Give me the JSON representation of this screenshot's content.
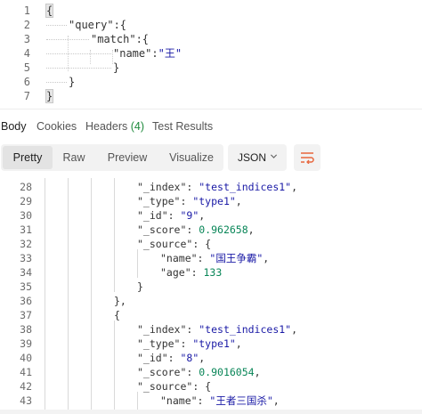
{
  "request_body": {
    "lines": [
      {
        "n": "1",
        "indent": 0,
        "parts": [
          {
            "t": "{",
            "c": "brace-sel"
          }
        ]
      },
      {
        "n": "2",
        "indent": 1,
        "parts": [
          {
            "t": "\"query\"",
            "c": "key"
          },
          {
            "t": ":{",
            "c": "p"
          }
        ]
      },
      {
        "n": "3",
        "indent": 2,
        "parts": [
          {
            "t": "\"match\"",
            "c": "key"
          },
          {
            "t": ":{",
            "c": "p"
          }
        ]
      },
      {
        "n": "4",
        "indent": 3,
        "parts": [
          {
            "t": "\"name\"",
            "c": "key"
          },
          {
            "t": ":",
            "c": "p"
          },
          {
            "t": "\"王\"",
            "c": "str"
          }
        ]
      },
      {
        "n": "5",
        "indent": 3,
        "parts": [
          {
            "t": "}",
            "c": "p"
          }
        ]
      },
      {
        "n": "6",
        "indent": 1,
        "parts": [
          {
            "t": "}",
            "c": "p"
          }
        ]
      },
      {
        "n": "7",
        "indent": 0,
        "parts": [
          {
            "t": "}",
            "c": "brace-sel"
          }
        ]
      }
    ]
  },
  "response_tabs": {
    "body": "Body",
    "cookies": "Cookies",
    "headers": "Headers",
    "headers_count": "(4)",
    "test_results": "Test Results"
  },
  "view_toolbar": {
    "pretty": "Pretty",
    "raw": "Raw",
    "preview": "Preview",
    "visualize": "Visualize",
    "format": "JSON",
    "chevron_icon": "chevron-down-icon",
    "wrap_icon": "wrap-lines-icon",
    "accent_color": "#e8663d"
  },
  "response_body": {
    "lines": [
      {
        "n": "28",
        "col": 5,
        "parts": [
          {
            "t": "\"_index\"",
            "c": "jk"
          },
          {
            "t": ": ",
            "c": "p"
          },
          {
            "t": "\"test_indices1\"",
            "c": "js"
          },
          {
            "t": ",",
            "c": "p"
          }
        ]
      },
      {
        "n": "29",
        "col": 5,
        "parts": [
          {
            "t": "\"_type\"",
            "c": "jk"
          },
          {
            "t": ": ",
            "c": "p"
          },
          {
            "t": "\"type1\"",
            "c": "js"
          },
          {
            "t": ",",
            "c": "p"
          }
        ]
      },
      {
        "n": "30",
        "col": 5,
        "parts": [
          {
            "t": "\"_id\"",
            "c": "jk"
          },
          {
            "t": ": ",
            "c": "p"
          },
          {
            "t": "\"9\"",
            "c": "js"
          },
          {
            "t": ",",
            "c": "p"
          }
        ]
      },
      {
        "n": "31",
        "col": 5,
        "parts": [
          {
            "t": "\"_score\"",
            "c": "jk"
          },
          {
            "t": ": ",
            "c": "p"
          },
          {
            "t": "0.962658",
            "c": "jn"
          },
          {
            "t": ",",
            "c": "p"
          }
        ]
      },
      {
        "n": "32",
        "col": 5,
        "parts": [
          {
            "t": "\"_source\"",
            "c": "jk"
          },
          {
            "t": ": {",
            "c": "p"
          }
        ]
      },
      {
        "n": "33",
        "col": 6,
        "parts": [
          {
            "t": "\"name\"",
            "c": "jk"
          },
          {
            "t": ": ",
            "c": "p"
          },
          {
            "t": "\"国王争霸\"",
            "c": "js"
          },
          {
            "t": ",",
            "c": "p"
          }
        ]
      },
      {
        "n": "34",
        "col": 6,
        "parts": [
          {
            "t": "\"age\"",
            "c": "jk"
          },
          {
            "t": ": ",
            "c": "p"
          },
          {
            "t": "133",
            "c": "jn"
          }
        ]
      },
      {
        "n": "35",
        "col": 5,
        "parts": [
          {
            "t": "}",
            "c": "p"
          }
        ]
      },
      {
        "n": "36",
        "col": 4,
        "parts": [
          {
            "t": "},",
            "c": "p"
          }
        ]
      },
      {
        "n": "37",
        "col": 4,
        "parts": [
          {
            "t": "{",
            "c": "p"
          }
        ]
      },
      {
        "n": "38",
        "col": 5,
        "parts": [
          {
            "t": "\"_index\"",
            "c": "jk"
          },
          {
            "t": ": ",
            "c": "p"
          },
          {
            "t": "\"test_indices1\"",
            "c": "js"
          },
          {
            "t": ",",
            "c": "p"
          }
        ]
      },
      {
        "n": "39",
        "col": 5,
        "parts": [
          {
            "t": "\"_type\"",
            "c": "jk"
          },
          {
            "t": ": ",
            "c": "p"
          },
          {
            "t": "\"type1\"",
            "c": "js"
          },
          {
            "t": ",",
            "c": "p"
          }
        ]
      },
      {
        "n": "40",
        "col": 5,
        "parts": [
          {
            "t": "\"_id\"",
            "c": "jk"
          },
          {
            "t": ": ",
            "c": "p"
          },
          {
            "t": "\"8\"",
            "c": "js"
          },
          {
            "t": ",",
            "c": "p"
          }
        ]
      },
      {
        "n": "41",
        "col": 5,
        "parts": [
          {
            "t": "\"_score\"",
            "c": "jk"
          },
          {
            "t": ": ",
            "c": "p"
          },
          {
            "t": "0.9016054",
            "c": "jn"
          },
          {
            "t": ",",
            "c": "p"
          }
        ]
      },
      {
        "n": "42",
        "col": 5,
        "parts": [
          {
            "t": "\"_source\"",
            "c": "jk"
          },
          {
            "t": ": {",
            "c": "p"
          }
        ]
      },
      {
        "n": "43",
        "col": 6,
        "parts": [
          {
            "t": "\"name\"",
            "c": "jk"
          },
          {
            "t": ": ",
            "c": "p"
          },
          {
            "t": "\"王者三国杀\"",
            "c": "js"
          },
          {
            "t": ",",
            "c": "p"
          }
        ]
      }
    ]
  }
}
